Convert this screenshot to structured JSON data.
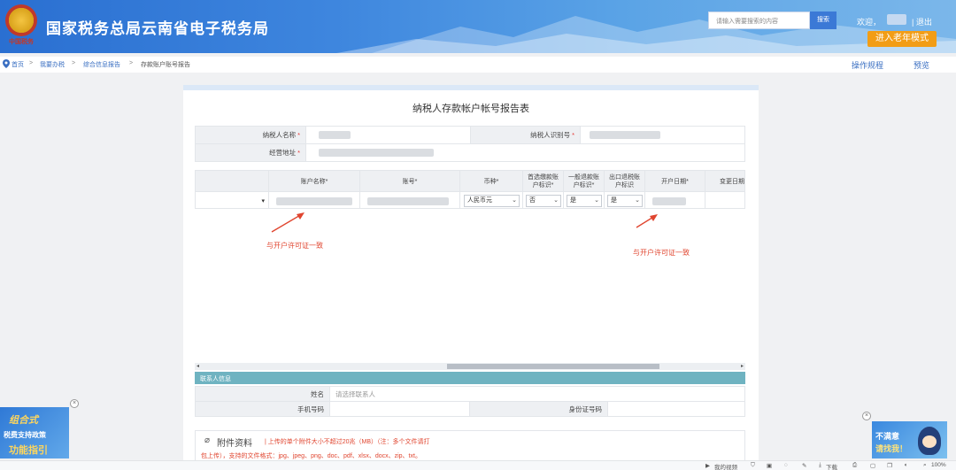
{
  "header": {
    "emblem_text": "中国税务",
    "title": "国家税务总局云南省电子税务局",
    "search_placeholder": "请输入需要搜索的内容",
    "search_button": "搜索",
    "welcome": "欢迎，",
    "logout": "退出",
    "elder_mode": "进入老年模式"
  },
  "breadcrumb": {
    "items": [
      "首页",
      "我要办税",
      "综合信息报告",
      "存款账户账号报告"
    ],
    "separator": ">"
  },
  "top_links": {
    "guide": "操作规程",
    "preview": "预览"
  },
  "form": {
    "title": "纳税人存款帐户帐号报告表",
    "taxpayer_name_label": "纳税人名称",
    "taxpayer_id_label": "纳税人识别号",
    "address_label": "经营地址",
    "required_mark": "*"
  },
  "account_grid": {
    "headers": [
      "账户名称*",
      "账号*",
      "币种*",
      "首选缴款账户标识*",
      "一般退款账户标识*",
      "出口退税账户标识",
      "开户日期*",
      "变更日期"
    ],
    "row": {
      "currency": "人民币元",
      "preferred": "否",
      "general_refund": "是",
      "export_refund": "是"
    }
  },
  "annotations": {
    "left_note": "与开户许可证一致",
    "right_note": "与开户许可证一致"
  },
  "contact": {
    "section_title": "联系人信息",
    "name_label": "姓名",
    "name_placeholder": "请选择联系人",
    "phone_label": "手机号码",
    "id_label": "身份证号码"
  },
  "attachment": {
    "title": "附件资料",
    "note_line1": "| 上传的单个附件大小不超过20兆（MB）（注：多个文件请打",
    "note_line2": "包上传），支持的文件格式：jpg、jpeg、png、doc、pdf、xlsx、docx、zip、txt。"
  },
  "ads": {
    "left_line1": "组合式",
    "left_line2": "税费支持政策",
    "left_line3": "功能指引",
    "right_line1": "不满意",
    "right_line2": "请找我！"
  },
  "statusbar": {
    "video": "我的视频",
    "download": "下载",
    "zoom": "100%"
  },
  "colors": {
    "header_blue": "#2a6fd1",
    "elder_orange": "#f29d16",
    "note_red": "#e0452f",
    "contact_teal": "#6fb3c1"
  }
}
